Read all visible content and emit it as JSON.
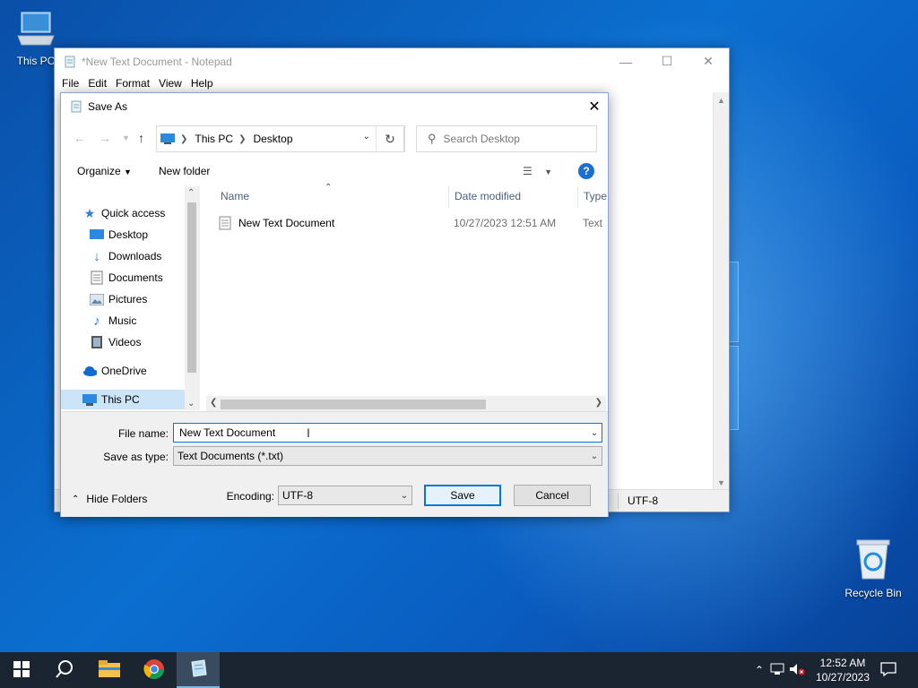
{
  "desktop": {
    "icons": [
      {
        "label": "This PC",
        "icon": "this-pc-icon"
      },
      {
        "label": "Recycle Bin",
        "icon": "recycle-bin-icon"
      }
    ]
  },
  "notepad": {
    "title": "*New Text Document - Notepad",
    "menu": [
      "File",
      "Edit",
      "Format",
      "View",
      "Help"
    ],
    "status_encoding": "UTF-8"
  },
  "dialog": {
    "title": "Save As",
    "address": {
      "crumbs": [
        "This PC",
        "Desktop"
      ]
    },
    "search_placeholder": "Search Desktop",
    "toolbar": {
      "organize": "Organize",
      "new_folder": "New folder",
      "help": "?"
    },
    "tree": [
      {
        "label": "Quick access",
        "icon": "star-icon",
        "pinned": false
      },
      {
        "label": "Desktop",
        "icon": "desktop-folder-icon",
        "pinned": true
      },
      {
        "label": "Downloads",
        "icon": "download-icon",
        "pinned": true
      },
      {
        "label": "Documents",
        "icon": "documents-icon",
        "pinned": true
      },
      {
        "label": "Pictures",
        "icon": "pictures-icon",
        "pinned": true
      },
      {
        "label": "Music",
        "icon": "music-icon",
        "pinned": false
      },
      {
        "label": "Videos",
        "icon": "videos-icon",
        "pinned": false
      },
      {
        "label": "OneDrive",
        "icon": "onedrive-icon",
        "pinned": false
      },
      {
        "label": "This PC",
        "icon": "this-pc-icon",
        "pinned": false
      }
    ],
    "columns": {
      "name": "Name",
      "date": "Date modified",
      "type": "Type"
    },
    "files": [
      {
        "name": "New Text Document",
        "date": "10/27/2023 12:51 AM",
        "type": "Text D"
      }
    ],
    "file_name_label": "File name:",
    "file_name_value": "New Text Document",
    "save_type_label": "Save as type:",
    "save_type_value": "Text Documents (*.txt)",
    "encoding_label": "Encoding:",
    "encoding_value": "UTF-8",
    "save_button": "Save",
    "cancel_button": "Cancel",
    "hide_folders": "Hide Folders"
  },
  "taskbar": {
    "clock_time": "12:52 AM",
    "clock_date": "10/27/2023"
  },
  "colors": {
    "accent": "#0078d7",
    "selection": "#cce4f7",
    "taskbar": "#1b2431"
  }
}
